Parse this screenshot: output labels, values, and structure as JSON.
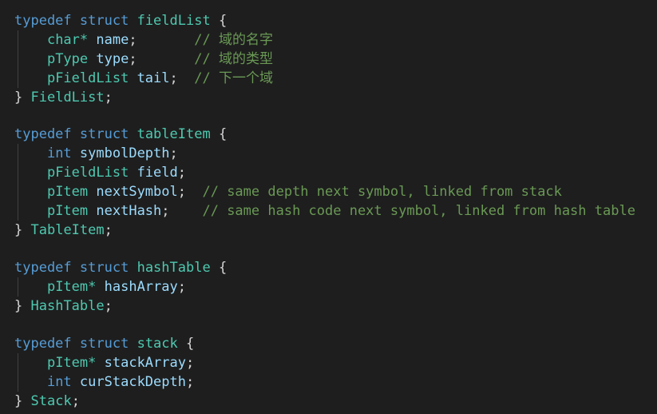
{
  "colors": {
    "background": "#1e1e1e",
    "keyword": "#569cd6",
    "type": "#4ec9b0",
    "identifier": "#9cdcfe",
    "punctuation": "#d4d4d4",
    "comment": "#6a9955"
  },
  "code": {
    "l1": {
      "kw1": "typedef",
      "kw2": "struct",
      "name": "fieldList",
      "brace": "{"
    },
    "l2": {
      "type": "char*",
      "var": "name",
      "semi": ";",
      "comment": "// 域的名字"
    },
    "l3": {
      "type": "pType",
      "var": "type",
      "semi": ";",
      "comment": "// 域的类型"
    },
    "l4": {
      "type": "pFieldList",
      "var": "tail",
      "semi": ";",
      "comment": "// 下一个域"
    },
    "l5": {
      "brace": "}",
      "alias": "FieldList",
      "semi": ";"
    },
    "l7": {
      "kw1": "typedef",
      "kw2": "struct",
      "name": "tableItem",
      "brace": "{"
    },
    "l8": {
      "type": "int",
      "var": "symbolDepth",
      "semi": ";"
    },
    "l9": {
      "type": "pFieldList",
      "var": "field",
      "semi": ";"
    },
    "l10": {
      "type": "pItem",
      "var": "nextSymbol",
      "semi": ";",
      "comment": "// same depth next symbol, linked from stack"
    },
    "l11": {
      "type": "pItem",
      "var": "nextHash",
      "semi": ";",
      "comment": "// same hash code next symbol, linked from hash table"
    },
    "l12": {
      "brace": "}",
      "alias": "TableItem",
      "semi": ";"
    },
    "l14": {
      "kw1": "typedef",
      "kw2": "struct",
      "name": "hashTable",
      "brace": "{"
    },
    "l15": {
      "type": "pItem*",
      "var": "hashArray",
      "semi": ";"
    },
    "l16": {
      "brace": "}",
      "alias": "HashTable",
      "semi": ";"
    },
    "l18": {
      "kw1": "typedef",
      "kw2": "struct",
      "name": "stack",
      "brace": "{"
    },
    "l19": {
      "type": "pItem*",
      "var": "stackArray",
      "semi": ";"
    },
    "l20": {
      "type": "int",
      "var": "curStackDepth",
      "semi": ";"
    },
    "l21": {
      "brace": "}",
      "alias": "Stack",
      "semi": ";"
    }
  }
}
